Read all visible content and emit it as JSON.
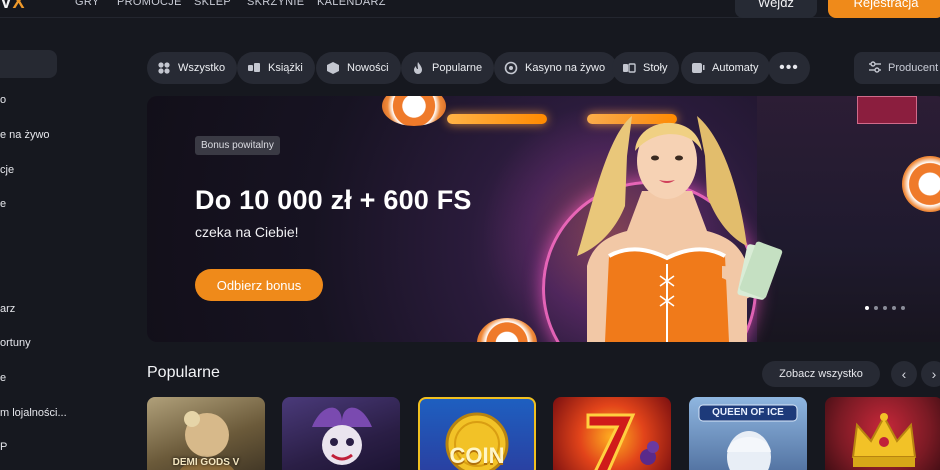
{
  "header": {
    "logo_main": "V",
    "logo_accent": "X",
    "nav": [
      "GRY",
      "PROMOCJE",
      "SKLEP",
      "SKRZYNIE",
      "KALENDARZ"
    ],
    "login_label": "Wejdź",
    "register_label": "Rejestracja"
  },
  "sidebar": {
    "items": [
      "o",
      "e na żywo",
      "cje",
      "e",
      "arz",
      "ortuny",
      "e",
      "m lojalności...",
      "P"
    ]
  },
  "filters": {
    "chips": [
      {
        "label": "Wszystko",
        "icon": "all-icon"
      },
      {
        "label": "Książki",
        "icon": "book-icon"
      },
      {
        "label": "Nowości",
        "icon": "new-icon"
      },
      {
        "label": "Popularne",
        "icon": "fire-icon"
      },
      {
        "label": "Kasyno na żywo",
        "icon": "live-casino-icon"
      },
      {
        "label": "Stoły",
        "icon": "tables-icon"
      },
      {
        "label": "Automaty",
        "icon": "slots-icon"
      }
    ],
    "more_label": "•••",
    "producer_label": "Producent"
  },
  "banner": {
    "badge": "Bonus powitalny",
    "headline": "Do 10 000 zł + 600 FS",
    "subline": "czeka na Ciebie!",
    "cta_label": "Odbierz bonus",
    "slide_count": 5,
    "active_slide": 1
  },
  "popular": {
    "title": "Popularne",
    "see_all_label": "Zobacz wszystko",
    "prev_icon": "chevron-left-icon",
    "next_icon": "chevron-right-icon",
    "games": [
      {
        "name": "DEMI GODS V",
        "color": "#6b5a3a"
      },
      {
        "name": "",
        "color": "#3a2a55"
      },
      {
        "name": "COIN",
        "color": "#f0c020"
      },
      {
        "name": "",
        "color": "#c0281a"
      },
      {
        "name": "QUEEN OF ICE",
        "color": "#5a7fb0"
      },
      {
        "name": "",
        "color": "#7a1a24"
      }
    ]
  },
  "colors": {
    "accent": "#ef8a1a",
    "background": "#16181f",
    "chip": "#272a34"
  }
}
